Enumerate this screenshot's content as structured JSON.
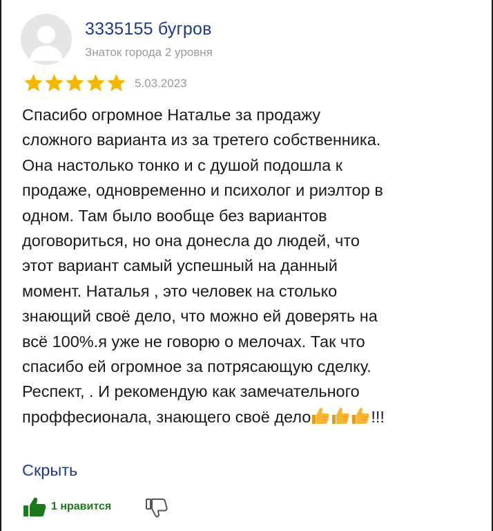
{
  "author": {
    "name": "3335155 бугров",
    "level": "Знаток города 2 уровня"
  },
  "rating": {
    "stars": 5,
    "max": 5,
    "color": "#f5b800"
  },
  "review": {
    "date": "5.03.2023",
    "lines": [
      "Спасибо огромное Наталье за продажу",
      "сложного варианта из за третего собственника.",
      "Она настолько тонко и с душой подошла к",
      "продаже, одновременно и психолог и риэлтор в",
      "одном. Там было вообще без вариантов",
      "договориться, но она донесла до людей, что",
      "этот вариант самый успешный на данный",
      "момент. Наталья , это человек на столько",
      "знающий своё дело, что можно ей доверять на",
      "всё 100%.я уже не говорю о мелочах. Так что",
      "спасибо ей огромное за потрясающую сделку.",
      "Респект, . И рекомендую как замечательного"
    ],
    "last_line_text": "проффесионала, знающего своё дело",
    "last_line_emoji": "thumbs-up-emoji x3",
    "last_line_suffix": "!!!",
    "collapse_label": "Скрыть"
  },
  "reactions": {
    "likes_label": "1 нравится",
    "like_icon": "thumbs-up-icon",
    "dislike_icon": "thumbs-down-icon",
    "like_color": "#1a7a1a",
    "link_color": "#1b3a8f"
  }
}
